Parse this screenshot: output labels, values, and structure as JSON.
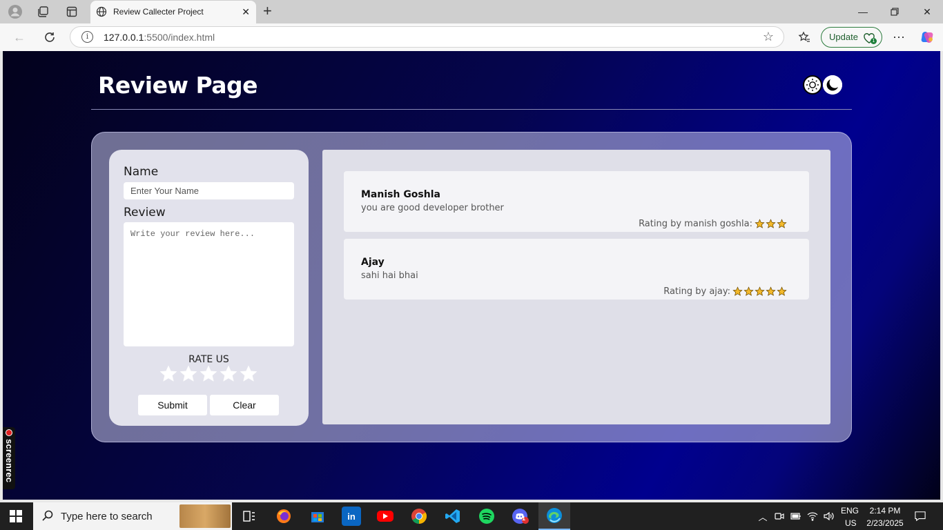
{
  "browser": {
    "tab_title": "Review Callecter Project",
    "url_host": "127.0.0.1",
    "url_path": ":5500/index.html",
    "update_label": "Update",
    "update_count": "1"
  },
  "page": {
    "title": "Review Page",
    "form": {
      "name_label": "Name",
      "name_placeholder": "Enter Your Name",
      "review_label": "Review",
      "review_placeholder": "Write your review here...",
      "rate_label": "RATE US",
      "rate_value": 0,
      "rate_max": 5,
      "submit_label": "Submit",
      "clear_label": "Clear"
    },
    "reviews": [
      {
        "name": "Manish Goshla",
        "text": "you are good developer brother",
        "rating_label": "Rating by manish goshla:",
        "rating": 3
      },
      {
        "name": "Ajay",
        "text": "sahi hai bhai",
        "rating_label": "Rating by ajay:",
        "rating": 5
      }
    ],
    "colors": {
      "star_fill": "#f3b92b",
      "star_stroke": "#6b4a00"
    }
  },
  "overlay": {
    "screenrec_label": "screenrec"
  },
  "taskbar": {
    "search_placeholder": "Type here to search",
    "language": "ENG",
    "region": "US",
    "time": "2:14 PM",
    "date": "2/23/2025",
    "chat_badge": "1"
  }
}
